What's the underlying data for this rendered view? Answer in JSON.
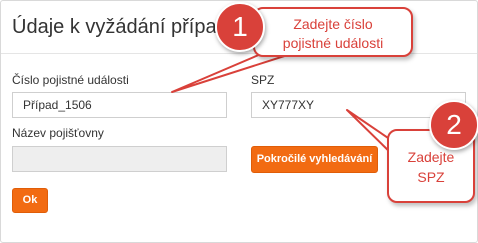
{
  "dialog": {
    "title": "Údaje k vyžádání případ"
  },
  "form": {
    "claim_number_label": "Číslo pojistné události",
    "claim_number_value": "Případ_1506",
    "spz_label": "SPZ",
    "spz_value": "XY777XY",
    "insurer_label": "Název pojišťovny",
    "insurer_value": "",
    "advanced_search_label": "Pokročilé vyhledávání",
    "ok_label": "Ok"
  },
  "callouts": [
    {
      "number": "1",
      "text_line1": "Zadejte číslo",
      "text_line2": "pojistné události"
    },
    {
      "number": "2",
      "text_line1": "Zadejte",
      "text_line2": "SPZ"
    }
  ],
  "colors": {
    "accent": "#f26b12",
    "callout": "#d9413a"
  }
}
